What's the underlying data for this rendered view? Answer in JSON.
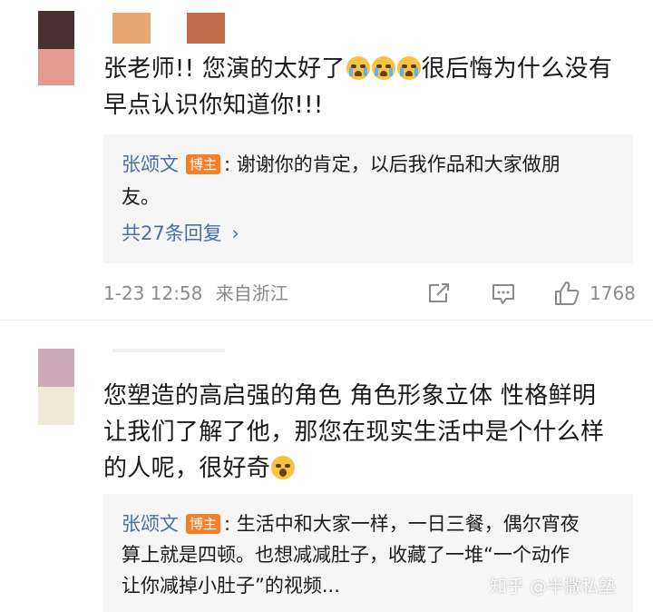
{
  "comments": [
    {
      "text_before_emoji": "张老师!! 您演的太好了",
      "emoji_count": 3,
      "emoji_name": "crying-face-icon",
      "text_after_emoji": "很后悔为什么没有",
      "text_line2": "早点认识你知道你!!!",
      "reply": {
        "author": "张颂文",
        "badge": "博主",
        "text_line1": ": 谢谢你的肯定，以后我作品和大家做朋",
        "text_line2": "友。",
        "more_label": "共27条回复",
        "more_chevron": "›"
      },
      "timestamp": "1-23 12:58",
      "location": "来自浙江",
      "like_count": "1768"
    },
    {
      "text_line1": "您塑造的高启强的角色 角色形象立体 性格鲜明",
      "text_line2": "让我们了解了他，那您在现实生活中是个什么样",
      "text_line3_before_emoji": "的人呢，很好奇",
      "emoji_name": "shocked-face-icon",
      "reply": {
        "author": "张颂文",
        "badge": "博主",
        "text_line1": ": 生活中和大家一样，一日三餐，偶尔宵夜",
        "text_line2": "算上就是四顿。也想减减肚子，收藏了一堆“一个动作",
        "text_line3": "让你减掉小肚子”的视频..."
      }
    }
  ],
  "watermark": "知乎 @半撒私塾",
  "colors": {
    "link": "#4a6fa5",
    "badge": "#f4802a",
    "reply_bg": "#f6f6f6",
    "meta": "#8a8a8a"
  }
}
